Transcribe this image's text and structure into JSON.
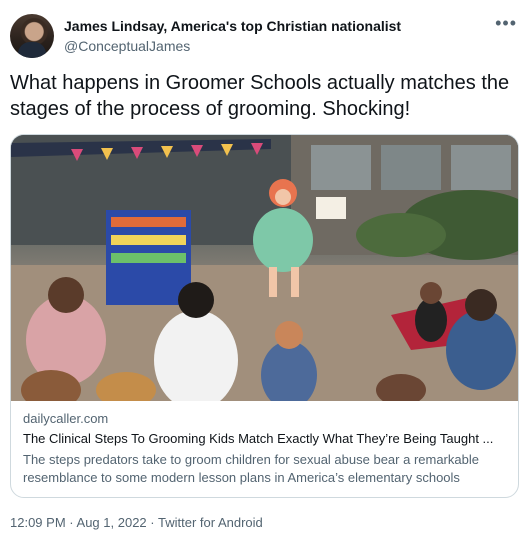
{
  "author": {
    "name": "James Lindsay, America's top Christian nationalist",
    "handle": "@ConceptualJames",
    "avatar_icon": "profile-photo-icon"
  },
  "more_icon": "…",
  "tweet_text": "What happens in Groomer Schools actually matches the stages of the process of grooming. Shocking!",
  "card": {
    "image_icon": "photo-drag-queen-story-hour",
    "domain": "dailycaller.com",
    "title": "The Clinical Steps To Grooming Kids Match Exactly What They’re Being Taught ...",
    "description": "The steps predators take to groom children for sexual abuse bear a remarkable resemblance to some modern lesson plans in America’s elementary schools"
  },
  "meta": {
    "time": "12:09 PM",
    "separator1": "·",
    "date": "Aug 1, 2022",
    "separator2": "·",
    "source": "Twitter for Android"
  },
  "colors": {
    "text_primary": "#0f1419",
    "text_secondary": "#536471",
    "border": "#cfd9de"
  }
}
